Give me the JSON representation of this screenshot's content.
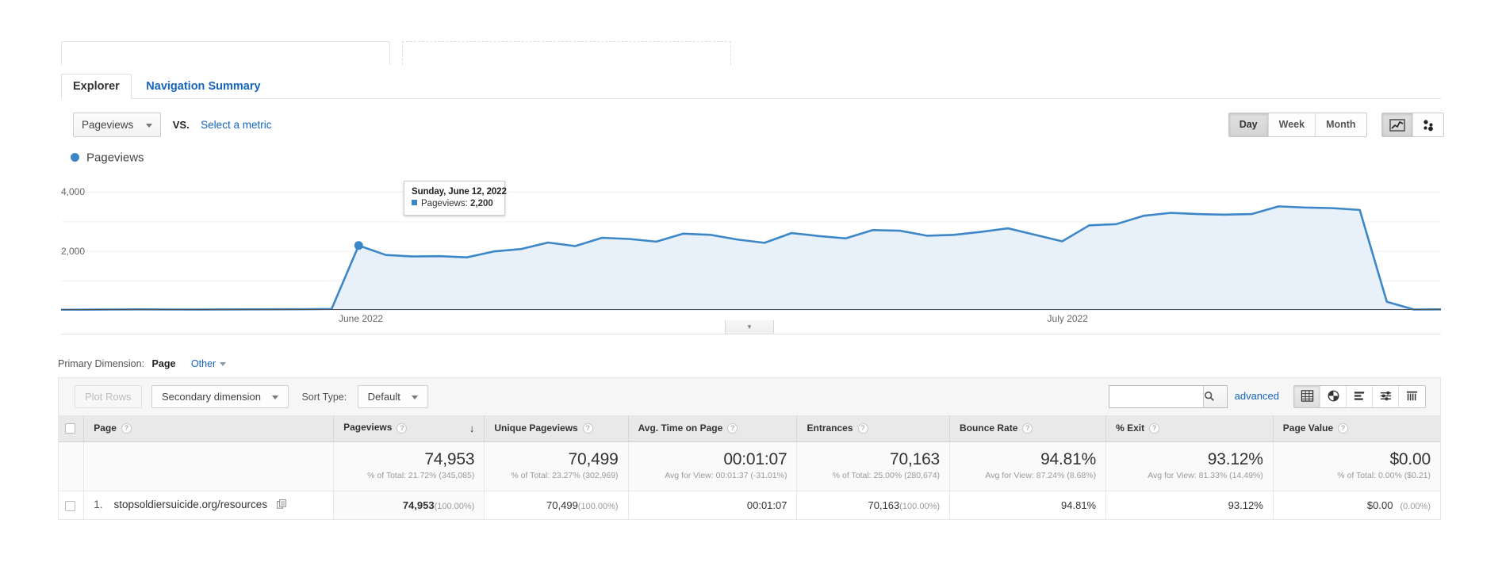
{
  "top_stubs": {
    "solid_label": "",
    "dashed_label": ""
  },
  "tabs": [
    {
      "label": "Explorer",
      "active": true
    },
    {
      "label": "Navigation Summary",
      "active": false
    }
  ],
  "metric_row": {
    "metric_button": "Pageviews",
    "vs_label": "VS.",
    "select_metric_link": "Select a metric"
  },
  "chart_controls": {
    "granularity": [
      {
        "label": "Day",
        "selected": true
      },
      {
        "label": "Week",
        "selected": false
      },
      {
        "label": "Month",
        "selected": false
      }
    ],
    "chart_types": [
      {
        "name": "line-chart-icon",
        "selected": true
      },
      {
        "name": "motion-chart-icon",
        "selected": false
      }
    ]
  },
  "chart_data": {
    "type": "area",
    "title": "Pageviews",
    "xlabel": "",
    "ylabel": "Pageviews",
    "ylim": [
      0,
      4600
    ],
    "yticks": [
      2000,
      4000
    ],
    "ytick_labels": [
      "2,000",
      "4,000"
    ],
    "grid": true,
    "legend": [
      {
        "label": "Pageviews",
        "color": "#3c87c8"
      }
    ],
    "xtick_labels": [
      "June 2022",
      "July 2022"
    ],
    "series": [
      {
        "name": "Pageviews",
        "color": "#3c87c8",
        "fill": "#e8f0f9",
        "x": [
          "Jun 1",
          "Jun 2",
          "Jun 3",
          "Jun 4",
          "Jun 5",
          "Jun 6",
          "Jun 7",
          "Jun 8",
          "Jun 9",
          "Jun 10",
          "Jun 11",
          "Jun 12",
          "Jun 13",
          "Jun 14",
          "Jun 15",
          "Jun 16",
          "Jun 17",
          "Jun 18",
          "Jun 19",
          "Jun 20",
          "Jun 21",
          "Jun 22",
          "Jun 23",
          "Jun 24",
          "Jun 25",
          "Jun 26",
          "Jun 27",
          "Jun 28",
          "Jun 29",
          "Jun 30",
          "Jul 1",
          "Jul 2",
          "Jul 3",
          "Jul 4",
          "Jul 5",
          "Jul 6",
          "Jul 7",
          "Jul 8",
          "Jul 9",
          "Jul 10",
          "Jul 11",
          "Jul 12",
          "Jul 13",
          "Jul 14",
          "Jul 15",
          "Jul 16",
          "Jul 17",
          "Jul 18",
          "Jul 19",
          "Jul 20",
          "Jul 21",
          "Jul 22"
        ],
        "values": [
          30,
          35,
          40,
          45,
          40,
          38,
          42,
          45,
          48,
          50,
          60,
          2200,
          1880,
          1830,
          1840,
          1800,
          2000,
          2080,
          2300,
          2180,
          2460,
          2420,
          2330,
          2600,
          2560,
          2400,
          2290,
          2620,
          2520,
          2440,
          2720,
          2700,
          2530,
          2560,
          2660,
          2780,
          2560,
          2340,
          2880,
          2920,
          3200,
          3300,
          3260,
          3240,
          3260,
          3520,
          3480,
          3460,
          3400,
          300,
          40,
          45
        ]
      }
    ],
    "tooltip": {
      "date": "Sunday, June 12, 2022",
      "metric_label": "Pageviews:",
      "metric_value": "2,200",
      "swatch_color": "#3c87c8"
    }
  },
  "axis_collapse_icon": "▾",
  "primary_dimension": {
    "label": "Primary Dimension:",
    "value": "Page",
    "other_link": "Other"
  },
  "toolbar": {
    "plot_rows_label": "Plot Rows",
    "secondary_dimension_label": "Secondary dimension",
    "sort_type_label": "Sort Type:",
    "sort_type_value": "Default",
    "search_value": "",
    "search_placeholder": "",
    "advanced_link": "advanced",
    "view_icons": [
      {
        "name": "table-view-icon",
        "selected": true
      },
      {
        "name": "pie-chart-view-icon",
        "selected": false
      },
      {
        "name": "bar-chart-view-icon",
        "selected": false
      },
      {
        "name": "comparison-view-icon",
        "selected": false
      },
      {
        "name": "pivot-view-icon",
        "selected": false
      }
    ]
  },
  "table": {
    "columns": [
      {
        "label": "Page",
        "sorted": false
      },
      {
        "label": "Pageviews",
        "sorted": true,
        "sort_icon": "↓"
      },
      {
        "label": "Unique Pageviews",
        "sorted": false
      },
      {
        "label": "Avg. Time on Page",
        "sorted": false
      },
      {
        "label": "Entrances",
        "sorted": false
      },
      {
        "label": "Bounce Rate",
        "sorted": false
      },
      {
        "label": "% Exit",
        "sorted": false
      },
      {
        "label": "Page Value",
        "sorted": false
      }
    ],
    "summary": [
      {
        "value": "74,953",
        "sub": "% of Total: 21.72% (345,085)"
      },
      {
        "value": "70,499",
        "sub": "% of Total: 23.27% (302,969)"
      },
      {
        "value": "00:01:07",
        "sub": "Avg for View: 00:01:37 (-31.01%)"
      },
      {
        "value": "70,163",
        "sub": "% of Total: 25.00% (280,674)"
      },
      {
        "value": "94.81%",
        "sub": "Avg for View: 87.24% (8.68%)"
      },
      {
        "value": "93.12%",
        "sub": "Avg for View: 81.33% (14.49%)"
      },
      {
        "value": "$0.00",
        "sub": "% of Total: 0.00% ($0.21)"
      }
    ],
    "rows": [
      {
        "index": "1.",
        "page": "stopsoldiersuicide.org/resources",
        "pageviews": "74,953",
        "pageviews_pct": "(100.00%)",
        "unique_pageviews": "70,499",
        "unique_pageviews_pct": "(100.00%)",
        "avg_time_on_page": "00:01:07",
        "entrances": "70,163",
        "entrances_pct": "(100.00%)",
        "bounce_rate": "94.81%",
        "pct_exit": "93.12%",
        "page_value": "$0.00",
        "page_value_pct": "(0.00%)"
      }
    ]
  }
}
